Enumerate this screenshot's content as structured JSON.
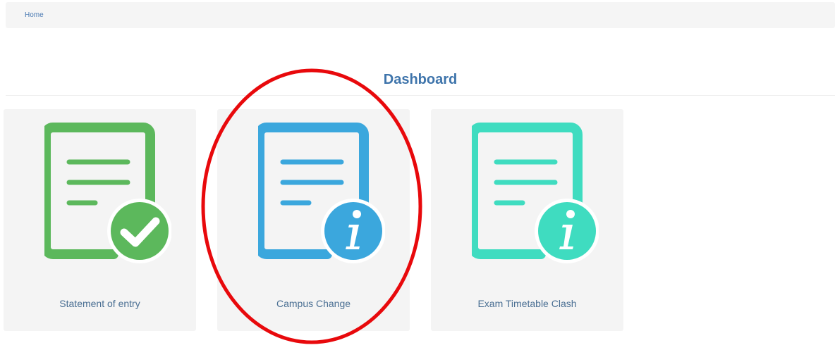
{
  "breadcrumb": {
    "home_label": "Home"
  },
  "page": {
    "title": "Dashboard"
  },
  "tiles": [
    {
      "label": "Statement of entry",
      "icon": "document-check-icon",
      "color": "#5cb85c"
    },
    {
      "label": "Campus Change",
      "icon": "document-info-icon",
      "color": "#3ba7dd"
    },
    {
      "label": "Exam Timetable Clash",
      "icon": "document-info-icon",
      "color": "#3fdcc0"
    }
  ],
  "annotation": {
    "color": "#e8090c",
    "shape": "ellipse"
  }
}
